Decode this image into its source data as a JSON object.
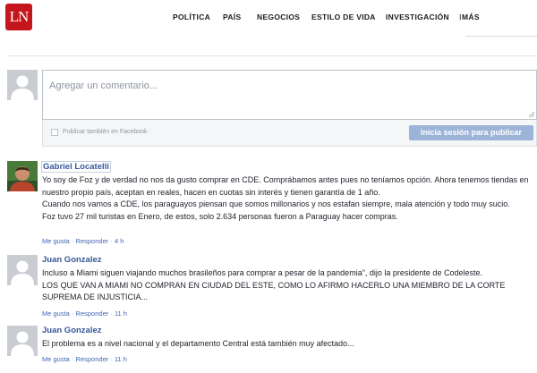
{
  "header": {
    "logo_text": "LN",
    "nav": [
      "POLÍTICA",
      "PAÍS",
      "NEGOCIOS",
      "ESTILO DE VIDA",
      "INVESTIGACIÓN",
      "⁝MÁS"
    ]
  },
  "compose": {
    "placeholder": "Agregar un comentario...",
    "facebook_label": "Publicar también en Facebook",
    "facebook_checked": false,
    "submit_label": "Inicia sesión para publicar"
  },
  "comments": [
    {
      "author": "Gabriel Locatelli",
      "has_photo": true,
      "paragraphs": [
        "Yo soy de Foz y de verdad no nos da gusto comprar en CDE. Comprábamos antes pues no teníamos opción. Ahora tenemos tiendas en nuestro propio país, aceptan en reales, hacen en cuotas sin interés y tienen garantía de 1 año.",
        "Cuando nos vamos a CDE, los paraguayos piensan que somos millonarios y nos estafan siempre, mala atención y todo muy sucio.",
        "Foz tuvo 27 mil turistas en Enero, de estos, solo 2.634 personas fueron a Paraguay hacer compras."
      ],
      "like": "Me gusta",
      "reply": "Responder",
      "time": "4 h"
    },
    {
      "author": "Juan Gonzalez",
      "has_photo": false,
      "paragraphs": [
        "Incluso a Miami siguen viajando muchos brasileños para comprar a pesar de la pandemia\", dijo la presidente de Codeleste.",
        "LOS QUE VAN A MIAMI NO COMPRAN EN CIUDAD DEL ESTE, COMO LO AFIRMO HACERLO UNA MIEMBRO DE LA CORTE SUPREMA DE INJUSTICIA..."
      ],
      "like": "Me gusta",
      "reply": "Responder",
      "time": "11 h"
    },
    {
      "author": "Juan Gonzalez",
      "has_photo": false,
      "paragraphs": [
        "El problema es a nivel nacional y el departamento Central está también muy afectado..."
      ],
      "like": "Me gusta",
      "reply": "Responder",
      "time": "11 h"
    }
  ],
  "colors": {
    "brand_red": "#c4161c",
    "link_blue": "#365899",
    "button_disabled": "#9cb4d8"
  }
}
